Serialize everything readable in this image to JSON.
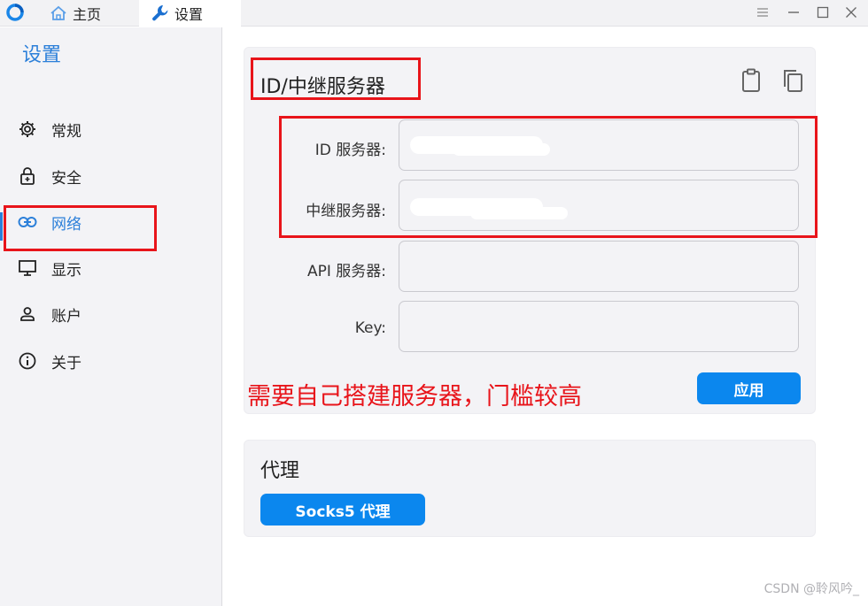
{
  "titlebar": {
    "tabs": [
      {
        "label": "主页",
        "icon": "home-icon"
      },
      {
        "label": "设置",
        "icon": "wrench-icon"
      }
    ],
    "controls": [
      "menu-icon",
      "minimize-icon",
      "maximize-icon",
      "close-icon"
    ]
  },
  "sidebar": {
    "title": "设置",
    "items": [
      {
        "label": "常规",
        "icon": "gear-icon",
        "active": false
      },
      {
        "label": "安全",
        "icon": "lock-icon",
        "active": false
      },
      {
        "label": "网络",
        "icon": "link-icon",
        "active": true
      },
      {
        "label": "显示",
        "icon": "monitor-icon",
        "active": false
      },
      {
        "label": "账户",
        "icon": "user-icon",
        "active": false
      },
      {
        "label": "关于",
        "icon": "info-icon",
        "active": false
      }
    ]
  },
  "server_card": {
    "title": "ID/中继服务器",
    "fields": [
      {
        "label": "ID 服务器:",
        "value": ""
      },
      {
        "label": "中继服务器:",
        "value": ""
      },
      {
        "label": "API 服务器:",
        "value": ""
      },
      {
        "label": "Key:",
        "value": ""
      }
    ],
    "apply_label": "应用"
  },
  "proxy_card": {
    "title": "代理",
    "socks_label": "Socks5 代理"
  },
  "annotation": {
    "text": "需要自己搭建服务器，门槛较高",
    "color": "#e8141a"
  },
  "watermark": "CSDN @聆风吟_",
  "colors": {
    "accent": "#2b7fd9",
    "button": "#0b87ee"
  }
}
